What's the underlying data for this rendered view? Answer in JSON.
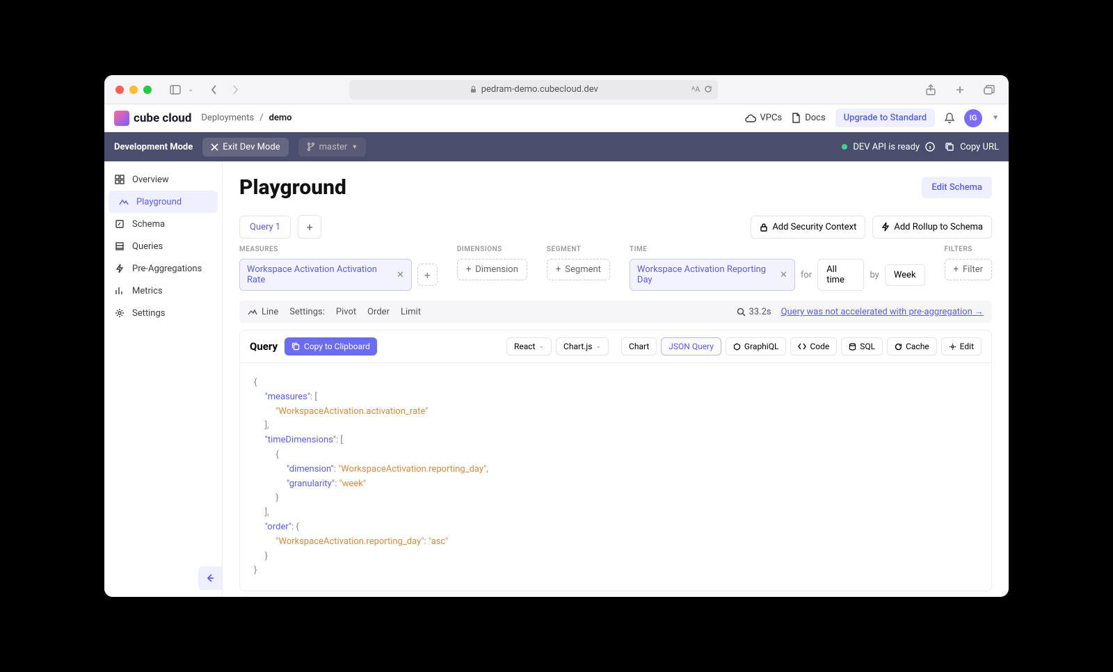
{
  "browser": {
    "url": "pedram-demo.cubecloud.dev"
  },
  "header": {
    "logo": "cube cloud",
    "crumb_root": "Deployments",
    "crumb_sep": "/",
    "crumb_leaf": "demo",
    "vpc": "VPCs",
    "docs": "Docs",
    "upgrade": "Upgrade to Standard",
    "avatar": "IG"
  },
  "devbar": {
    "mode": "Development Mode",
    "exit": "Exit Dev Mode",
    "branch": "master",
    "status": "DEV API is ready",
    "copy": "Copy URL"
  },
  "sidebar": {
    "items": [
      {
        "label": "Overview"
      },
      {
        "label": "Playground"
      },
      {
        "label": "Schema"
      },
      {
        "label": "Queries"
      },
      {
        "label": "Pre-Aggregations"
      },
      {
        "label": "Metrics"
      },
      {
        "label": "Settings"
      }
    ]
  },
  "page": {
    "title": "Playground",
    "edit": "Edit Schema"
  },
  "tabs": {
    "q1": "Query 1",
    "sec": "Add Security Context",
    "rollup": "Add Rollup to Schema"
  },
  "filters": {
    "measures_label": "MEASURES",
    "dimensions_label": "DIMENSIONS",
    "segment_label": "SEGMENT",
    "time_label": "TIME",
    "filters_label": "FILTERS",
    "measure_chip": "Workspace Activation Activation Rate",
    "dim_btn": "Dimension",
    "seg_btn": "Segment",
    "time_chip": "Workspace Activation Reporting Day",
    "for": "for",
    "alltime": "All time",
    "by": "by",
    "week": "Week",
    "filter_btn": "Filter"
  },
  "toolbar": {
    "line": "Line",
    "settings": "Settings:",
    "pivot": "Pivot",
    "order": "Order",
    "limit": "Limit",
    "time": "33.2s",
    "accel": "Query was not accelerated with pre-aggregation →"
  },
  "query": {
    "title": "Query",
    "copy": "Copy to Clipboard",
    "react": "React",
    "chartjs": "Chart.js",
    "chart": "Chart",
    "json": "JSON Query",
    "graphiql": "GraphiQL",
    "code": "Code",
    "sql": "SQL",
    "cache": "Cache",
    "edit": "Edit",
    "tok": {
      "measures": "\"measures\"",
      "timeDimensions": "\"timeDimensions\"",
      "dimension": "\"dimension\"",
      "granularity": "\"granularity\"",
      "order": "\"order\"",
      "v_ar": "\"WorkspaceActivation.activation_rate\"",
      "v_rd": "\"WorkspaceActivation.reporting_day\"",
      "v_week": "\"week\"",
      "v_asc": "\"asc\""
    }
  }
}
